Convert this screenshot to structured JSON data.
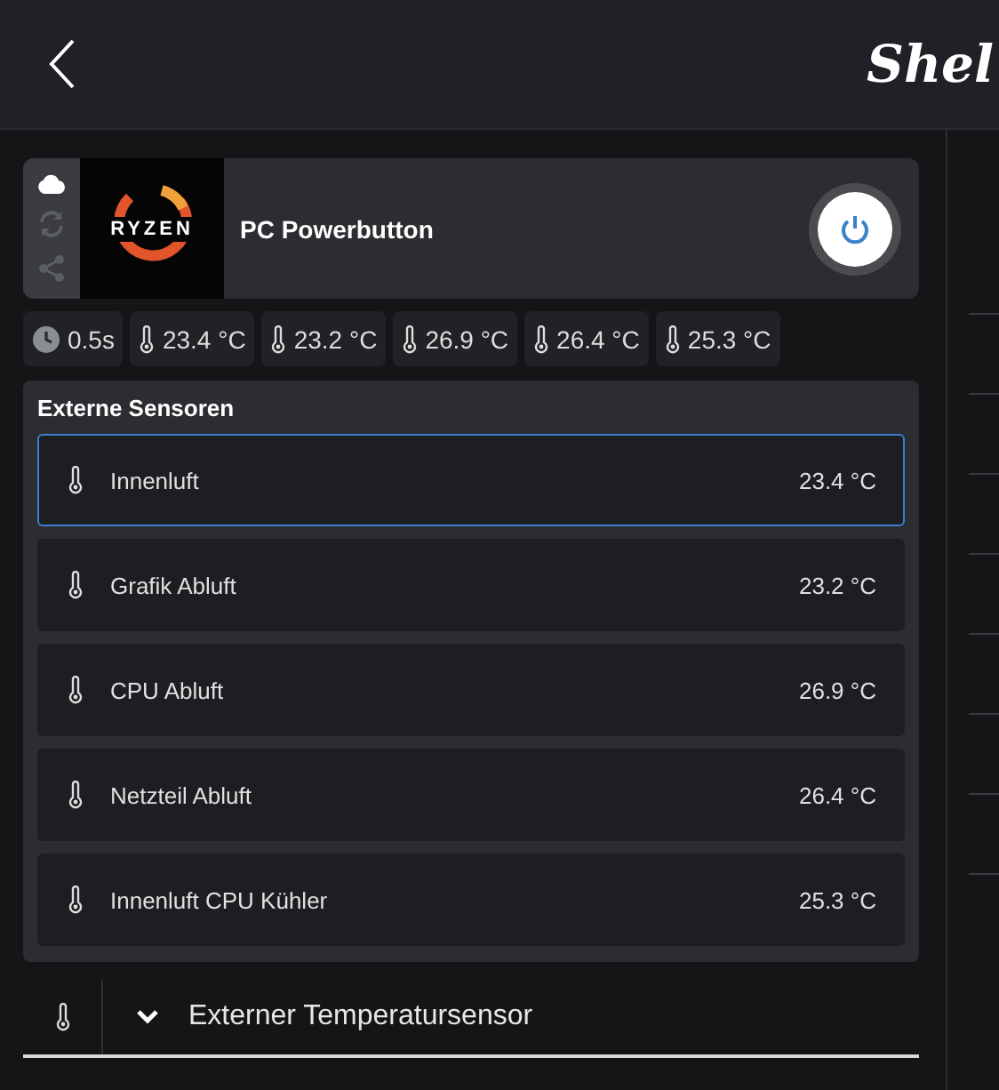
{
  "header": {
    "logo_text": "Shel"
  },
  "device": {
    "name": "PC Powerbutton",
    "image_text": "RYZEN",
    "power_on": true
  },
  "chips": [
    {
      "kind": "clock",
      "text": "0.5s"
    },
    {
      "kind": "temp",
      "text": "23.4 °C"
    },
    {
      "kind": "temp",
      "text": "23.2 °C"
    },
    {
      "kind": "temp",
      "text": "26.9 °C"
    },
    {
      "kind": "temp",
      "text": "26.4 °C"
    },
    {
      "kind": "temp",
      "text": "25.3 °C"
    }
  ],
  "sensors": {
    "title": "Externe Sensoren",
    "items": [
      {
        "name": "Innenluft",
        "value": "23.4 °C",
        "selected": true
      },
      {
        "name": "Grafik Abluft",
        "value": "23.2 °C",
        "selected": false
      },
      {
        "name": "CPU Abluft",
        "value": "26.9 °C",
        "selected": false
      },
      {
        "name": "Netzteil Abluft",
        "value": "26.4 °C",
        "selected": false
      },
      {
        "name": "Innenluft CPU Kühler",
        "value": "25.3 °C",
        "selected": false
      }
    ]
  },
  "section": {
    "title": "Externer Temperatursensor",
    "expanded": true
  }
}
